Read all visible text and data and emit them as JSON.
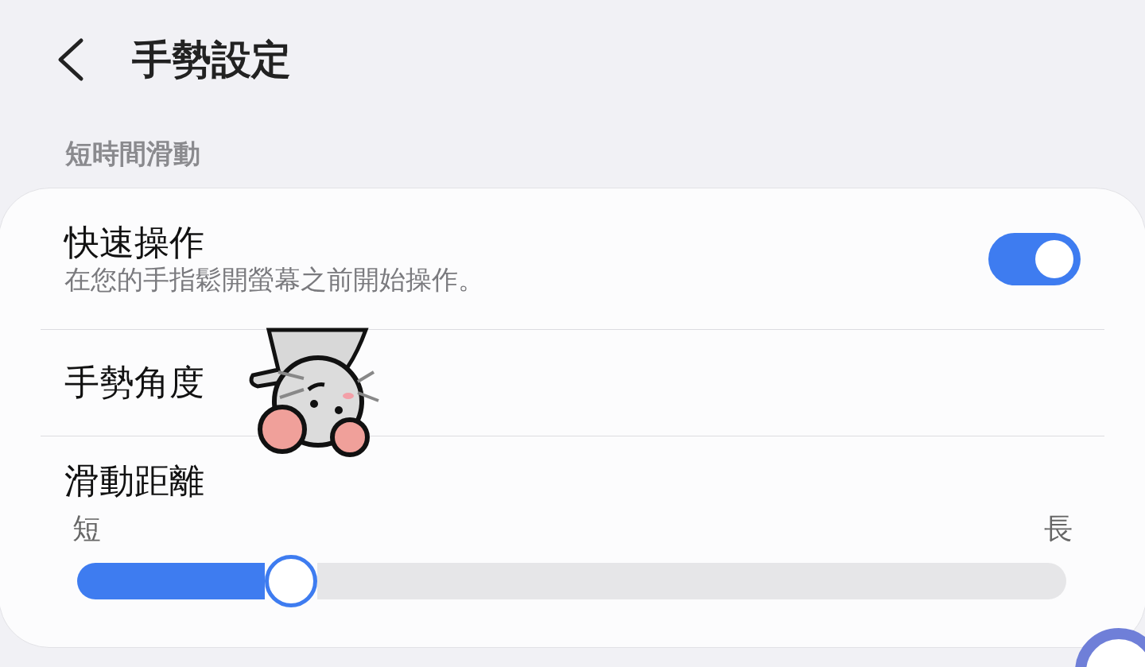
{
  "header": {
    "title": "手勢設定"
  },
  "section": {
    "title": "短時間滑動"
  },
  "items": [
    {
      "kind": "toggle",
      "title": "快速操作",
      "subtitle": "在您的手指鬆開螢幕之前開始操作。",
      "on": true
    },
    {
      "kind": "plain",
      "title": "手勢角度"
    },
    {
      "kind": "slider",
      "title": "滑動距離",
      "min_label": "短",
      "max_label": "長",
      "level": 0.2
    }
  ]
}
